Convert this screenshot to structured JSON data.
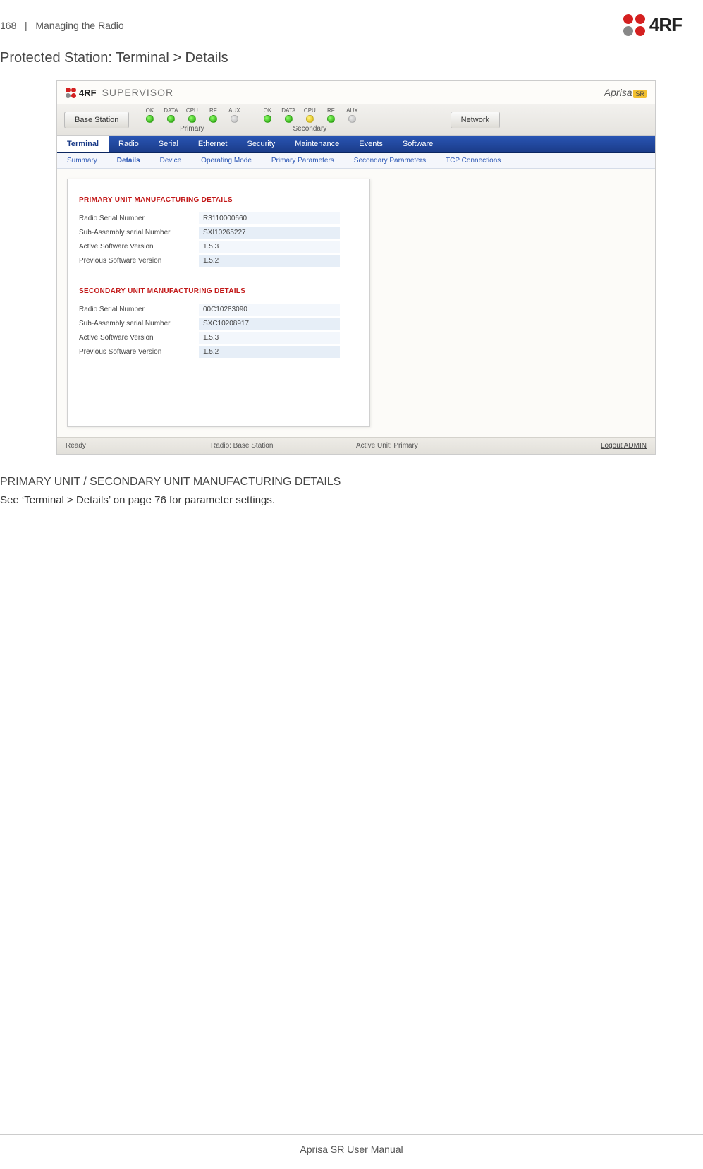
{
  "page": {
    "number": "168",
    "section_path": "Managing the Radio",
    "brand": "4RF",
    "main_heading": "Protected Station: Terminal > Details",
    "sub_heading": "PRIMARY UNIT / SECONDARY UNIT MANUFACTURING DETAILS",
    "body_text": "See ‘Terminal > Details’ on page 76 for parameter settings.",
    "footer": "Aprisa SR User Manual"
  },
  "supervisor": {
    "app_name": "SUPERVISOR",
    "product": "Aprisa",
    "product_suffix": "SR",
    "toolbar": {
      "base_station_btn": "Base Station",
      "network_btn": "Network",
      "led_cols": [
        "OK",
        "DATA",
        "CPU",
        "RF",
        "AUX"
      ],
      "primary": {
        "label": "Primary",
        "leds": [
          "green",
          "green",
          "green",
          "green",
          "gray"
        ]
      },
      "secondary": {
        "label": "Secondary",
        "leds": [
          "green",
          "green",
          "yellow",
          "green",
          "gray"
        ]
      }
    },
    "menubar": [
      "Terminal",
      "Radio",
      "Serial",
      "Ethernet",
      "Security",
      "Maintenance",
      "Events",
      "Software"
    ],
    "menubar_active": "Terminal",
    "submenu": [
      "Summary",
      "Details",
      "Device",
      "Operating Mode",
      "Primary Parameters",
      "Secondary Parameters",
      "TCP Connections"
    ],
    "submenu_active": "Details",
    "panels": {
      "primary": {
        "title": "PRIMARY UNIT MANUFACTURING DETAILS",
        "rows": [
          {
            "label": "Radio Serial Number",
            "value": "R3110000660"
          },
          {
            "label": "Sub-Assembly serial Number",
            "value": "SXI10265227"
          },
          {
            "label": "Active Software Version",
            "value": "1.5.3"
          },
          {
            "label": "Previous Software Version",
            "value": "1.5.2"
          }
        ]
      },
      "secondary": {
        "title": "SECONDARY UNIT MANUFACTURING DETAILS",
        "rows": [
          {
            "label": "Radio Serial Number",
            "value": "00C10283090"
          },
          {
            "label": "Sub-Assembly serial Number",
            "value": "SXC10208917"
          },
          {
            "label": "Active Software Version",
            "value": "1.5.3"
          },
          {
            "label": "Previous Software Version",
            "value": "1.5.2"
          }
        ]
      }
    },
    "statusbar": {
      "ready": "Ready",
      "radio": "Radio: Base Station",
      "active_unit": "Active Unit: Primary",
      "logout": "Logout ADMIN"
    }
  }
}
